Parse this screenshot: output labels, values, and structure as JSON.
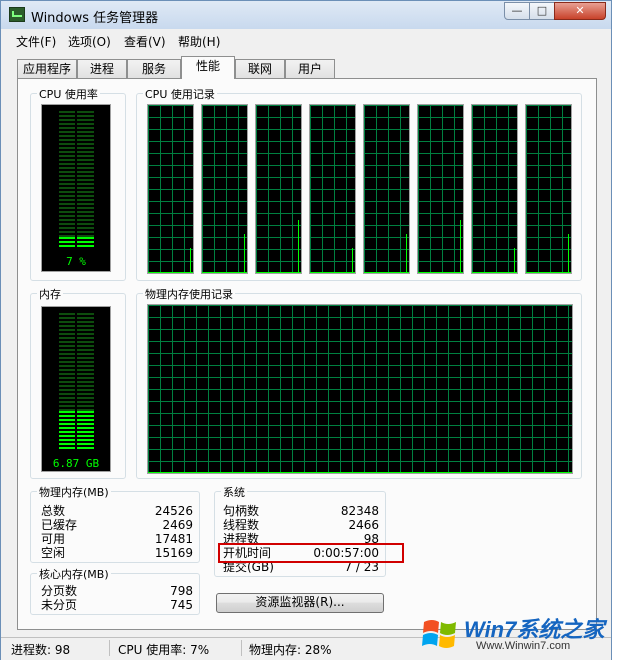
{
  "window": {
    "title": "Windows 任务管理器",
    "minimize": "—",
    "maximize": "□",
    "close": "✕"
  },
  "menu": [
    "文件(F)",
    "选项(O)",
    "查看(V)",
    "帮助(H)"
  ],
  "tabs": [
    "应用程序",
    "进程",
    "服务",
    "性能",
    "联网",
    "用户"
  ],
  "active_tab": "性能",
  "cpu": {
    "usage_label": "CPU 使用率",
    "usage_value": "7 %",
    "usage_fraction": 0.07,
    "history_label": "CPU 使用记录",
    "core_count": 8
  },
  "memory": {
    "label": "内存",
    "value": "6.87 GB",
    "usage_fraction": 0.28,
    "history_label": "物理内存使用记录"
  },
  "physical_memory": {
    "header": "物理内存(MB)",
    "rows": [
      {
        "k": "总数",
        "v": "24526"
      },
      {
        "k": "已缓存",
        "v": "2469"
      },
      {
        "k": "可用",
        "v": "17481"
      },
      {
        "k": "空闲",
        "v": "15169"
      }
    ]
  },
  "kernel_memory": {
    "header": "核心内存(MB)",
    "rows": [
      {
        "k": "分页数",
        "v": "798"
      },
      {
        "k": "未分页",
        "v": "745"
      }
    ]
  },
  "system": {
    "header": "系统",
    "rows": [
      {
        "k": "句柄数",
        "v": "82348"
      },
      {
        "k": "线程数",
        "v": "2466"
      },
      {
        "k": "进程数",
        "v": "98"
      },
      {
        "k": "开机时间",
        "v": "0:00:57:00"
      },
      {
        "k": "提交(GB)",
        "v": "7 / 23"
      }
    ]
  },
  "resource_monitor_button": "资源监视器(R)...",
  "status": {
    "processes": "进程数: 98",
    "cpu": "CPU 使用率: 7%",
    "memory": "物理内存: 28%"
  },
  "watermark": {
    "brand": "Win7系统之家",
    "url": "Www.Winwin7.com"
  },
  "colors": {
    "meter_on": "#00ff00",
    "grid": "#008040",
    "highlight": "#d00000"
  }
}
